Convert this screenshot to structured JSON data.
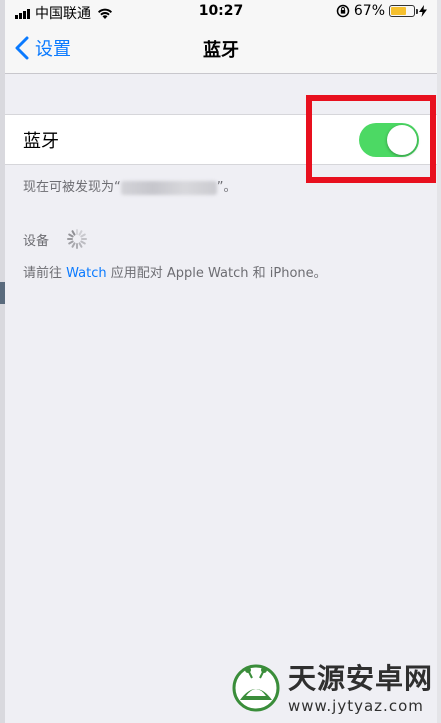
{
  "status_bar": {
    "carrier": "中国联通",
    "time": "10:27",
    "battery_percent": "67%",
    "battery_level": 0.67,
    "icons": [
      "signal-icon",
      "wifi-icon",
      "rotation-lock-icon",
      "battery-icon",
      "charging-icon"
    ]
  },
  "nav": {
    "back_label": "设置",
    "title": "蓝牙"
  },
  "bluetooth": {
    "label": "蓝牙",
    "enabled": true,
    "toggle_color": "#4cd964",
    "discoverable_prefix": "现在可被发现为“",
    "discoverable_suffix": "”。"
  },
  "devices": {
    "header": "设备"
  },
  "watch_note": {
    "prefix": "请前往 ",
    "link": "Watch",
    "suffix": " 应用配对 Apple Watch 和 iPhone。"
  },
  "watermark": {
    "name": "天源安卓网",
    "url": "www.jytyaz.com"
  },
  "colors": {
    "accent": "#0a7aff",
    "highlight": "#e8101e",
    "background": "#efeff4"
  }
}
